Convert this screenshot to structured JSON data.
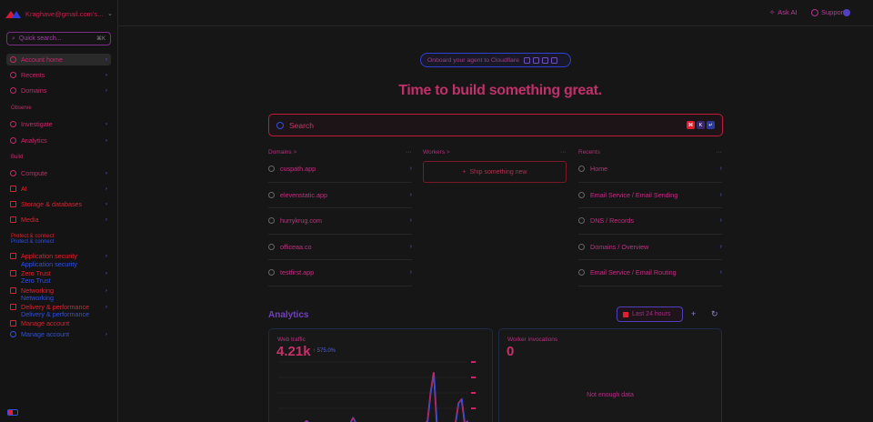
{
  "sidebar": {
    "account": "Kraghave@gmail.com's...",
    "quick_search": {
      "placeholder": "Quick search...",
      "shortcut": "⌘K"
    },
    "top_items": [
      {
        "label": "Account home"
      },
      {
        "label": "Recents"
      },
      {
        "label": "Domains"
      }
    ],
    "sections": {
      "observe": "Observe",
      "build": "Build",
      "protect": "Protect & connect",
      "protect_sub": "Protect & connect"
    },
    "observe_items": [
      {
        "label": "Investigate"
      },
      {
        "label": "Analytics"
      }
    ],
    "build_items": [
      {
        "label": "Compute"
      },
      {
        "label": "AI"
      },
      {
        "label": "Storage & databases"
      },
      {
        "label": "Media"
      }
    ],
    "protect_items": [
      {
        "label": "Application security",
        "sub": "Application security"
      },
      {
        "label": "Zero Trust",
        "sub": "Zero Trust"
      },
      {
        "label": "Networking",
        "sub": "Networking"
      },
      {
        "label": "Delivery & performance",
        "sub": "Delivery & performance"
      },
      {
        "label": "Manage account"
      }
    ],
    "manage": "Manage account"
  },
  "topbar": {
    "ask_ai": "Ask AI",
    "support": "Support"
  },
  "agent_banner": "Onboard your agent to Cloudflare",
  "hero_title": "Time to build something great.",
  "search": {
    "placeholder": "Search"
  },
  "columns": {
    "domains": {
      "header": "Domains >",
      "items": [
        "cuspath.app",
        "elevenstatic.app",
        "hurrykrug.com",
        "officeaa.co",
        "testfirst.app"
      ]
    },
    "workers": {
      "header": "Workers >",
      "ship": "Ship something new"
    },
    "recents": {
      "header": "Recents",
      "items": [
        "Home",
        "Email Service / Email Sending",
        "DNS / Records",
        "Domains / Overview",
        "Email Service / Email Routing"
      ]
    }
  },
  "analytics": {
    "title": "Analytics",
    "range": "Last 24 hours",
    "web_traffic": {
      "title": "Web traffic",
      "value": "4.21k",
      "delta": "↑ 575.0%"
    },
    "worker_invocations": {
      "title": "Worker invocations",
      "value": "0",
      "empty": "Not enough data"
    }
  },
  "chart_data": {
    "type": "line",
    "title": "Web traffic",
    "ylim": [
      0,
      1200
    ],
    "series": [
      {
        "values": [
          0,
          0,
          0,
          0,
          0,
          0,
          0,
          0,
          0,
          60,
          0,
          0,
          0,
          0,
          0,
          0,
          0,
          0,
          0,
          0,
          0,
          0,
          0,
          0,
          120,
          0,
          0,
          0,
          0,
          0,
          0,
          0,
          0,
          0,
          0,
          0,
          0,
          0,
          0,
          0,
          0,
          0,
          0,
          0,
          0,
          0,
          0,
          0,
          50,
          600,
          1000,
          0,
          0,
          0,
          0,
          0,
          0,
          0,
          400,
          480,
          0,
          60
        ]
      }
    ]
  },
  "colors": {
    "accent_red": "#e02030",
    "accent_blue": "#3050e0",
    "accent_magenta": "#c8286a"
  }
}
